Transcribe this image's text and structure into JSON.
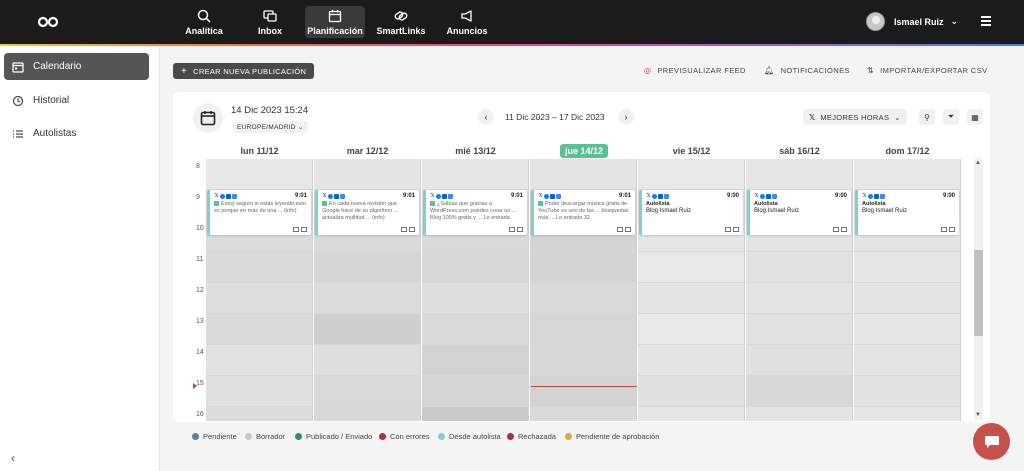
{
  "nav": {
    "items": [
      {
        "label": "Analítica",
        "icon": "analytics-icon"
      },
      {
        "label": "Inbox",
        "icon": "inbox-icon"
      },
      {
        "label": "Planificación",
        "icon": "calendar-icon"
      },
      {
        "label": "SmartLinks",
        "icon": "link-icon"
      },
      {
        "label": "Anuncios",
        "icon": "megaphone-icon"
      }
    ],
    "active": "Planificación",
    "user_name": "Ismael Ruiz"
  },
  "sidebar": {
    "items": [
      {
        "label": "Calendario",
        "icon": "calendar-icon"
      },
      {
        "label": "Historial",
        "icon": "history-icon"
      },
      {
        "label": "Autolistas",
        "icon": "list-icon"
      }
    ]
  },
  "toolbar": {
    "create_label": "CREAR NUEVA PUBLICACIÓN",
    "preview_label": "PREVISUALIZAR FEED",
    "notifications_label": "NOTIFICACIONES",
    "import_label": "IMPORTAR/EXPORTAR CSV"
  },
  "calendar": {
    "current_datetime": "14 Dic 2023 15:24",
    "timezone": "EUROPE/MADRID",
    "range": "11 Dic 2023  –  17 Dic 2023",
    "best_hours_label": "MEJORES HORAS",
    "days": [
      "lun 11/12",
      "mar 12/12",
      "mié 13/12",
      "jue 14/12",
      "vie 15/12",
      "sáb 16/12",
      "dom 17/12"
    ],
    "today_index": 3,
    "hours": [
      "8",
      "9",
      "10",
      "11",
      "12",
      "13",
      "14",
      "15",
      "16"
    ],
    "posts": [
      {
        "day": 0,
        "time": "9:01",
        "text": "Estoy seguro si estás leyendo esto es porque en más de una ... (info)"
      },
      {
        "day": 1,
        "time": "9:01",
        "text": "En cada nueva revisión que Google hace de su algoritmo ... actualiza multitud ... (info)"
      },
      {
        "day": 2,
        "time": "9:01",
        "text": "¿Sabías que gracias a WordPress.com puedes crear un ... Blog 100% gratis y ... Lo entrada"
      },
      {
        "day": 3,
        "time": "9:01",
        "text": "Poder descargar música gratis de YouTube es uno de las ... búsquedas más ... Lo entrada 32"
      },
      {
        "day": 4,
        "time": "9:00",
        "tag": "Autolista",
        "title": "Blog Ismael Ruiz"
      },
      {
        "day": 5,
        "time": "9:00",
        "tag": "Autolista",
        "title": "Blog Ismael Ruiz"
      },
      {
        "day": 6,
        "time": "9:00",
        "tag": "Autolista",
        "title": "Blog Ismael Ruiz"
      }
    ]
  },
  "legend": [
    {
      "label": "Pendiente",
      "color": "#5b7fa3"
    },
    {
      "label": "Borrador",
      "color": "#c9c9c9"
    },
    {
      "label": "Publicado / Enviado",
      "color": "#2e8b6b"
    },
    {
      "label": "Con errores",
      "color": "#b0303a"
    },
    {
      "label": "Desde autolista",
      "color": "#7fd1cb"
    },
    {
      "label": "Rechazada",
      "color": "#a8323a"
    },
    {
      "label": "Pendiente de aprobación",
      "color": "#d8a944"
    }
  ]
}
